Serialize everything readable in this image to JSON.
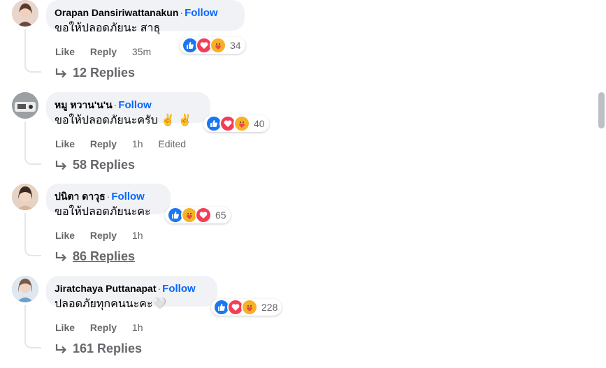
{
  "comments": [
    {
      "name": "Orapan Dansiriwattanakun",
      "follow": "Follow",
      "text": "ขอให้ปลอดภัยนะ สาธุ",
      "reactions": [
        "like",
        "love",
        "care"
      ],
      "reaction_count": "34",
      "like_label": "Like",
      "reply_label": "Reply",
      "time": "35m",
      "edited": "",
      "replies_label": "12 Replies",
      "avatar_color": "#d9b7a3"
    },
    {
      "name": "หมู หวาน'น'น",
      "follow": "Follow",
      "text": "ขอให้ปลอดภัยนะครับ ✌️ ✌️",
      "reactions": [
        "like",
        "love",
        "care"
      ],
      "reaction_count": "40",
      "like_label": "Like",
      "reply_label": "Reply",
      "time": "1h",
      "edited": "Edited",
      "replies_label": "58 Replies",
      "avatar_color": "#8a8f93"
    },
    {
      "name": "ปนิตา ดาวุธ",
      "follow": "Follow",
      "text": "ขอให้ปลอดภัยนะคะ",
      "reactions": [
        "like",
        "care",
        "love"
      ],
      "reaction_count": "65",
      "like_label": "Like",
      "reply_label": "Reply",
      "time": "1h",
      "edited": "",
      "replies_label": "86 Replies",
      "avatar_color": "#c9a58c"
    },
    {
      "name": "Jiratchaya Puttanapat",
      "follow": "Follow",
      "text": "ปลอดภัยทุกคนนะคะ🤍",
      "reactions": [
        "like",
        "love",
        "care"
      ],
      "reaction_count": "228",
      "like_label": "Like",
      "reply_label": "Reply",
      "time": "1h",
      "edited": "",
      "replies_label": "161 Replies",
      "avatar_color": "#7fa6c4"
    }
  ],
  "colors": {
    "accent": "#0866ff",
    "bubble": "#f0f2f5",
    "meta": "#65676b"
  }
}
